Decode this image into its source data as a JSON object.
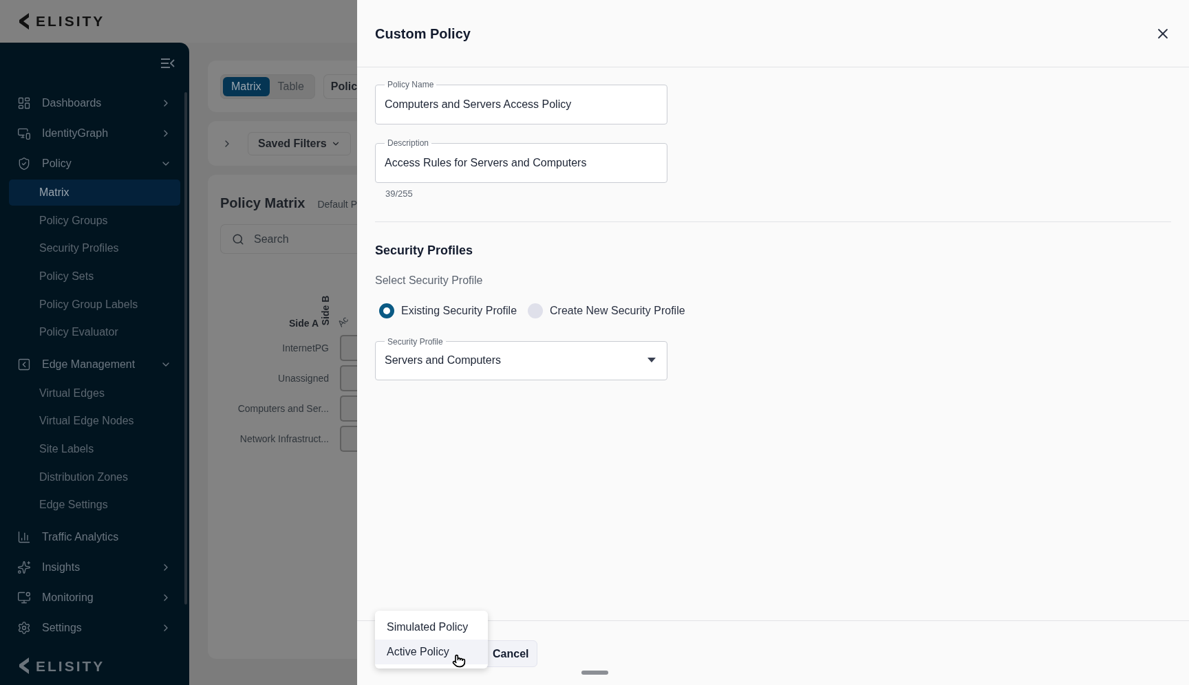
{
  "top_bar": {
    "logo": "ELISITY"
  },
  "sidebar": {
    "items": [
      {
        "label": "Dashboards",
        "expanded": false
      },
      {
        "label": "IdentityGraph",
        "expanded": false
      },
      {
        "label": "Policy",
        "expanded": true,
        "children": [
          {
            "label": "Matrix",
            "selected": true
          },
          {
            "label": "Policy Groups",
            "selected": false
          },
          {
            "label": "Security Profiles",
            "selected": false
          },
          {
            "label": "Policy Sets",
            "selected": false
          },
          {
            "label": "Policy Group Labels",
            "selected": false
          },
          {
            "label": "Policy Evaluator",
            "selected": false
          }
        ]
      },
      {
        "label": "Edge Management",
        "expanded": true,
        "children": [
          {
            "label": "Virtual Edges",
            "selected": false
          },
          {
            "label": "Virtual Edge Nodes",
            "selected": false
          },
          {
            "label": "Site Labels",
            "selected": false
          },
          {
            "label": "Distribution Zones",
            "selected": false
          },
          {
            "label": "Edge Settings",
            "selected": false
          }
        ]
      },
      {
        "label": "Traffic Analytics"
      },
      {
        "label": "Insights",
        "expanded": false
      },
      {
        "label": "Monitoring",
        "expanded": false
      },
      {
        "label": "Settings",
        "expanded": false
      }
    ],
    "footer_logo": "ELISITY"
  },
  "main": {
    "view_tabs": [
      {
        "label": "Matrix",
        "selected": true
      },
      {
        "label": "Table",
        "selected": false
      }
    ],
    "policy_button": "Polic",
    "saved_filters": "Saved Filters",
    "matrix": {
      "title": "Policy Matrix",
      "subtitle": "Default P",
      "search": {
        "placeholder": "Search"
      },
      "side_a": "Side A",
      "side_b": "Side B",
      "column_1": "Ac",
      "rows": [
        "InternetPG",
        "Unassigned",
        "Computers and Ser...",
        "Network Infrastruct..."
      ]
    }
  },
  "drawer": {
    "title": "Custom Policy",
    "fields": [
      {
        "label": "Policy Name",
        "value": "Computers and Servers Access Policy"
      },
      {
        "label": "Description",
        "value": "Access Rules for Servers and Computers",
        "counter": "39/255"
      }
    ],
    "section_title": "Security Profiles",
    "prompt": "Select Security Profile",
    "options": [
      {
        "label": "Existing Security Profile",
        "selected": true
      },
      {
        "label": "Create New Security Profile",
        "selected": false
      }
    ],
    "select": {
      "label": "Security Profile",
      "value": "Servers and Computers"
    },
    "menu": [
      {
        "label": "Simulated Policy",
        "highlighted": false
      },
      {
        "label": "Active Policy",
        "highlighted": true
      }
    ],
    "cancel": "Cancel"
  }
}
